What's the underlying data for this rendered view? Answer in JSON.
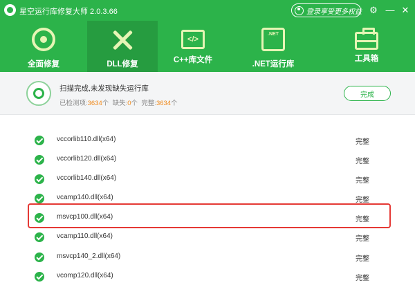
{
  "app": {
    "title": "星空运行库修复大师 2.0.3.66",
    "login_label": "登录享受更多权益"
  },
  "nav": {
    "tabs": [
      {
        "label": "全面修复",
        "active": false
      },
      {
        "label": "DLL修复",
        "active": true
      },
      {
        "label": "C++库文件",
        "active": false
      },
      {
        "label": ".NET运行库",
        "active": false
      },
      {
        "label": "工具箱",
        "active": false
      }
    ],
    "cpp_icon_text": "</>",
    "net_icon_text": ".NET"
  },
  "status": {
    "message": "扫描完成,未发现缺失运行库",
    "detected_label": "已检测项:",
    "detected_count": "3634",
    "missing_label": "缺失:",
    "missing_count": "0",
    "complete_label": "完整:",
    "complete_count": "3634",
    "unit": "个",
    "done_button": "完成"
  },
  "list": {
    "items": [
      {
        "name": "vccorlib110.dll(x64)",
        "status": "完整"
      },
      {
        "name": "vccorlib120.dll(x64)",
        "status": "完整"
      },
      {
        "name": "vccorlib140.dll(x64)",
        "status": "完整"
      },
      {
        "name": "vcamp140.dll(x64)",
        "status": "完整"
      },
      {
        "name": "msvcp100.dll(x64)",
        "status": "完整"
      },
      {
        "name": "vcamp110.dll(x64)",
        "status": "完整"
      },
      {
        "name": "msvcp140_2.dll(x64)",
        "status": "完整"
      },
      {
        "name": "vcomp120.dll(x64)",
        "status": "完整"
      }
    ]
  },
  "colors": {
    "brand_green": "#2cb34a",
    "active_tab": "#269c40",
    "count_orange": "#f08a1c",
    "highlight_red": "#e53935"
  }
}
